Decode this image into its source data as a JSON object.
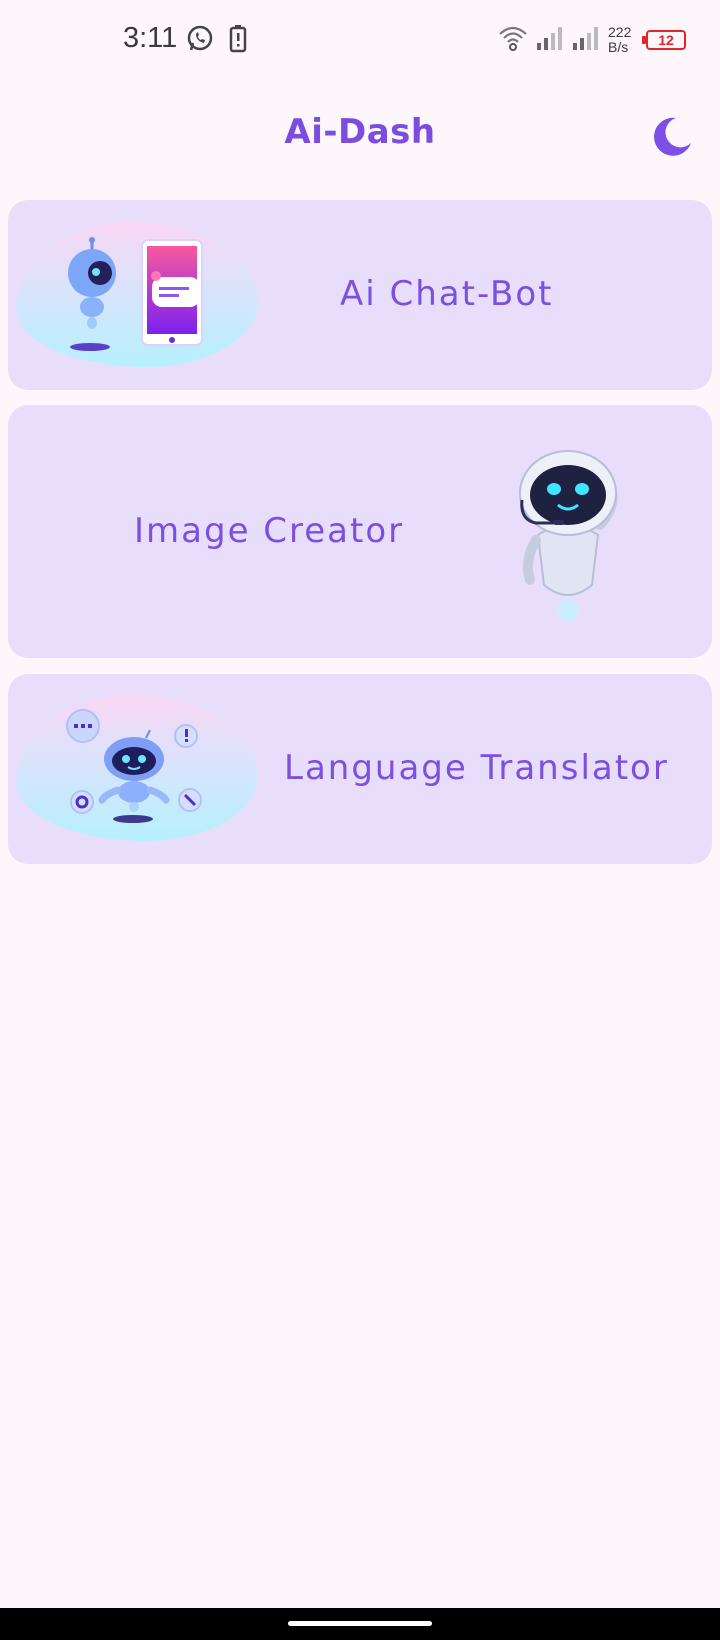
{
  "status_bar": {
    "time": "3:11",
    "net_speed_value": "222",
    "net_speed_unit": "B/s",
    "battery_level": "12",
    "icons": [
      "whatsapp-icon",
      "battery-saver-icon",
      "wifi-icon",
      "signal-icon",
      "signal-icon",
      "battery-icon"
    ]
  },
  "app_bar": {
    "title": "Ai-Dash",
    "theme_icon": "moon-icon"
  },
  "cards": [
    {
      "label": "Ai Chat-Bot",
      "image": "chatbot-robot-phone-illustration"
    },
    {
      "label": "Image Creator",
      "image": "waving-robot-illustration"
    },
    {
      "label": "Language Translator",
      "image": "robot-with-bubbles-illustration"
    }
  ],
  "colors": {
    "accent": "#7a4ce0",
    "card_bg": "#e8defb",
    "page_bg": "#fdf7fc"
  }
}
